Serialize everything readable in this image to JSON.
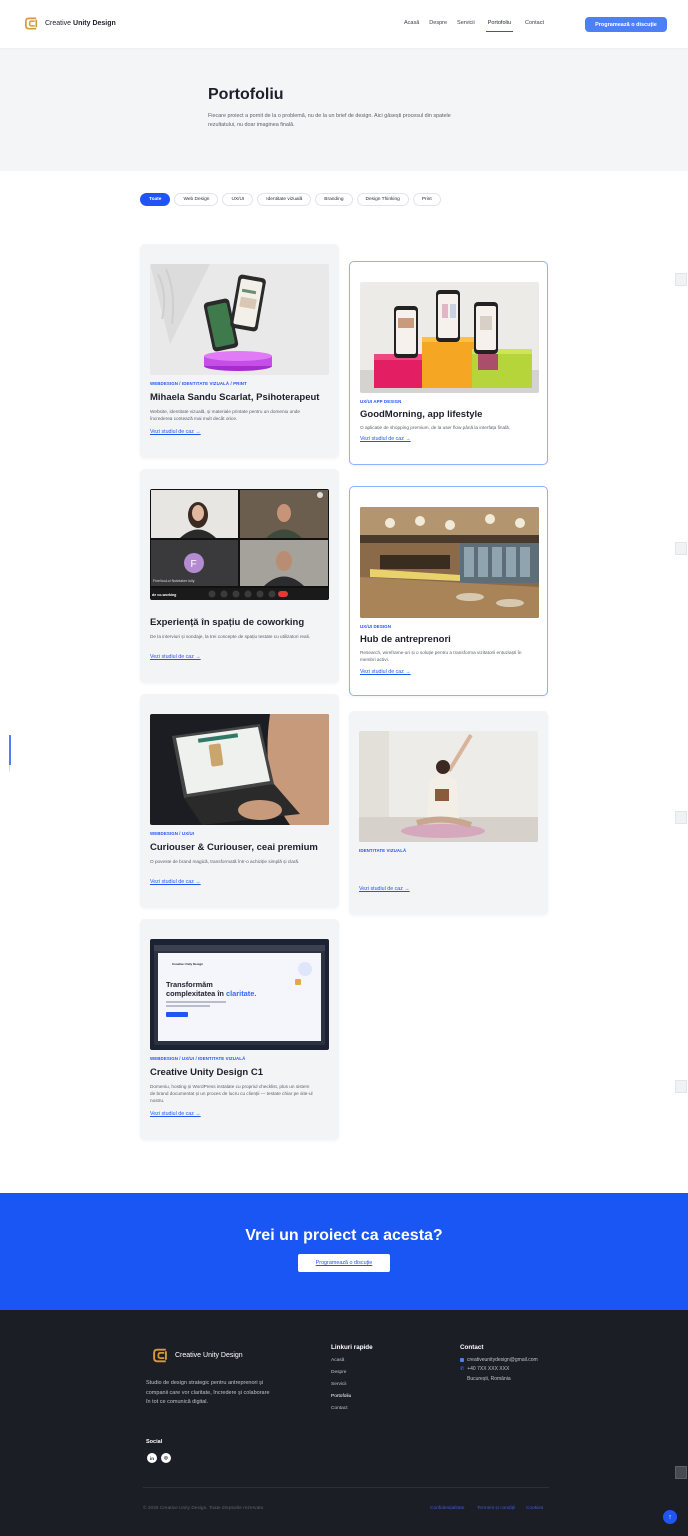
{
  "header": {
    "brand": "Creative Unity Design",
    "brand_prefix": "Creative ",
    "brand_strong": "Unity Design",
    "nav": [
      "Acasă",
      "Despre",
      "Servicii",
      "Portofoliu",
      "Contact"
    ],
    "active_nav": "Portofoliu",
    "cta": "Programează o discuție"
  },
  "hero": {
    "title": "Portofoliu",
    "text": "Fiecare proiect a pornit de la o problemă, nu de la un brief de design. Aici găsești procesul din spatele rezultatului, nu doar imaginea finală."
  },
  "filters": [
    "Toate",
    "Web Design",
    "UX/UI",
    "Identitate vizuală",
    "Branding",
    "Design Thinking",
    "Print"
  ],
  "active_filter": "Toate",
  "projects": [
    {
      "meta": "WEBDESIGN / IDENTITATE VIZUALĂ / PRINT",
      "title": "Mihaela Sandu Scarlat, Psihoterapeut",
      "desc": "Website, identitate vizuală, și materiale printate pentru un domeniu unde încrederea contează mai mult decât orice.",
      "link": "Vezi studiul de caz →"
    },
    {
      "meta": "UX/UI APP DESIGN",
      "title": "GoodMorning, app lifestyle",
      "desc": "O aplicație de shopping premium, de la user flow până la interfața finală.",
      "link": "Vezi studiul de caz →"
    },
    {
      "meta": "",
      "title": "Experiență în spațiu de coworking",
      "desc": "De la interviuri și sondaje, la trei concepte de spațiu testate cu utilizatori reali.",
      "link": "Vezi studiul de caz →",
      "call_labels": [
        "Fine!iouLol Notetaker Iully",
        "de co-working",
        "F"
      ]
    },
    {
      "meta": "UX/UI DESIGN",
      "title": "Hub de antreprenori",
      "desc": "Research, wireframe-uri și o soluție pentru a transforma vizitatorii entuziaști în membri activi.",
      "link": "Vezi studiul de caz →"
    },
    {
      "meta": "WEBDESIGN / UX/UI",
      "title": "Curiouser & Curiouser, ceai premium",
      "desc": "O poveste de brand magică, transformată într-o achiziție simplă și clară.",
      "link": "Vezi studiul de caz →"
    },
    {
      "meta": "IDENTITATE VIZUALĂ",
      "title": "",
      "desc": "",
      "link": "Vezi studiul de caz →"
    },
    {
      "meta": "WEBDESIGN / UX/UI / IDENTITATE VIZUALĂ",
      "title": "Creative Unity Design C1",
      "desc": "Domeniu, hosting și WordPress instalate cu propriul checklist, plus un sistem de brand documentat și un proces de lucru cu clienții — testate chiar pe site-ul nostru.",
      "link": "Vezi studiul de caz →",
      "mock": {
        "brand": "Creative Unity Design",
        "line1": "Transformăm",
        "line2": "complexitatea în",
        "line2_accent": "claritate."
      }
    }
  ],
  "cta_band": {
    "title": "Vrei un proiect ca acesta?",
    "button": "Programează o discuție"
  },
  "footer": {
    "brand": "Creative Unity Design",
    "about": "Studio de design strategic pentru antreprenori și companii care vor claritate, încredere și colaborare în tot ce comunică digital.",
    "social_title": "Social",
    "social": [
      "in",
      "◎"
    ],
    "links_title": "Linkuri rapide",
    "links": [
      "Acasă",
      "Despre",
      "Servicii",
      "Portofoliu",
      "Contact"
    ],
    "contact_title": "Contact",
    "email": "creativeunitydesign@gmail.com",
    "phone": "+40 7XX XXX XXX",
    "city": "București, România",
    "copyright": "© 2026 Creative Unity Design. Toate drepturile rezervate.",
    "legal": [
      "Confidențialitate",
      "Termeni și condiții",
      "Cookies"
    ]
  },
  "colors": {
    "accent": "#2055f4",
    "cta_band": "#1a56f4",
    "footer": "#1c1e26",
    "brand_gold": "#d69a3a"
  }
}
